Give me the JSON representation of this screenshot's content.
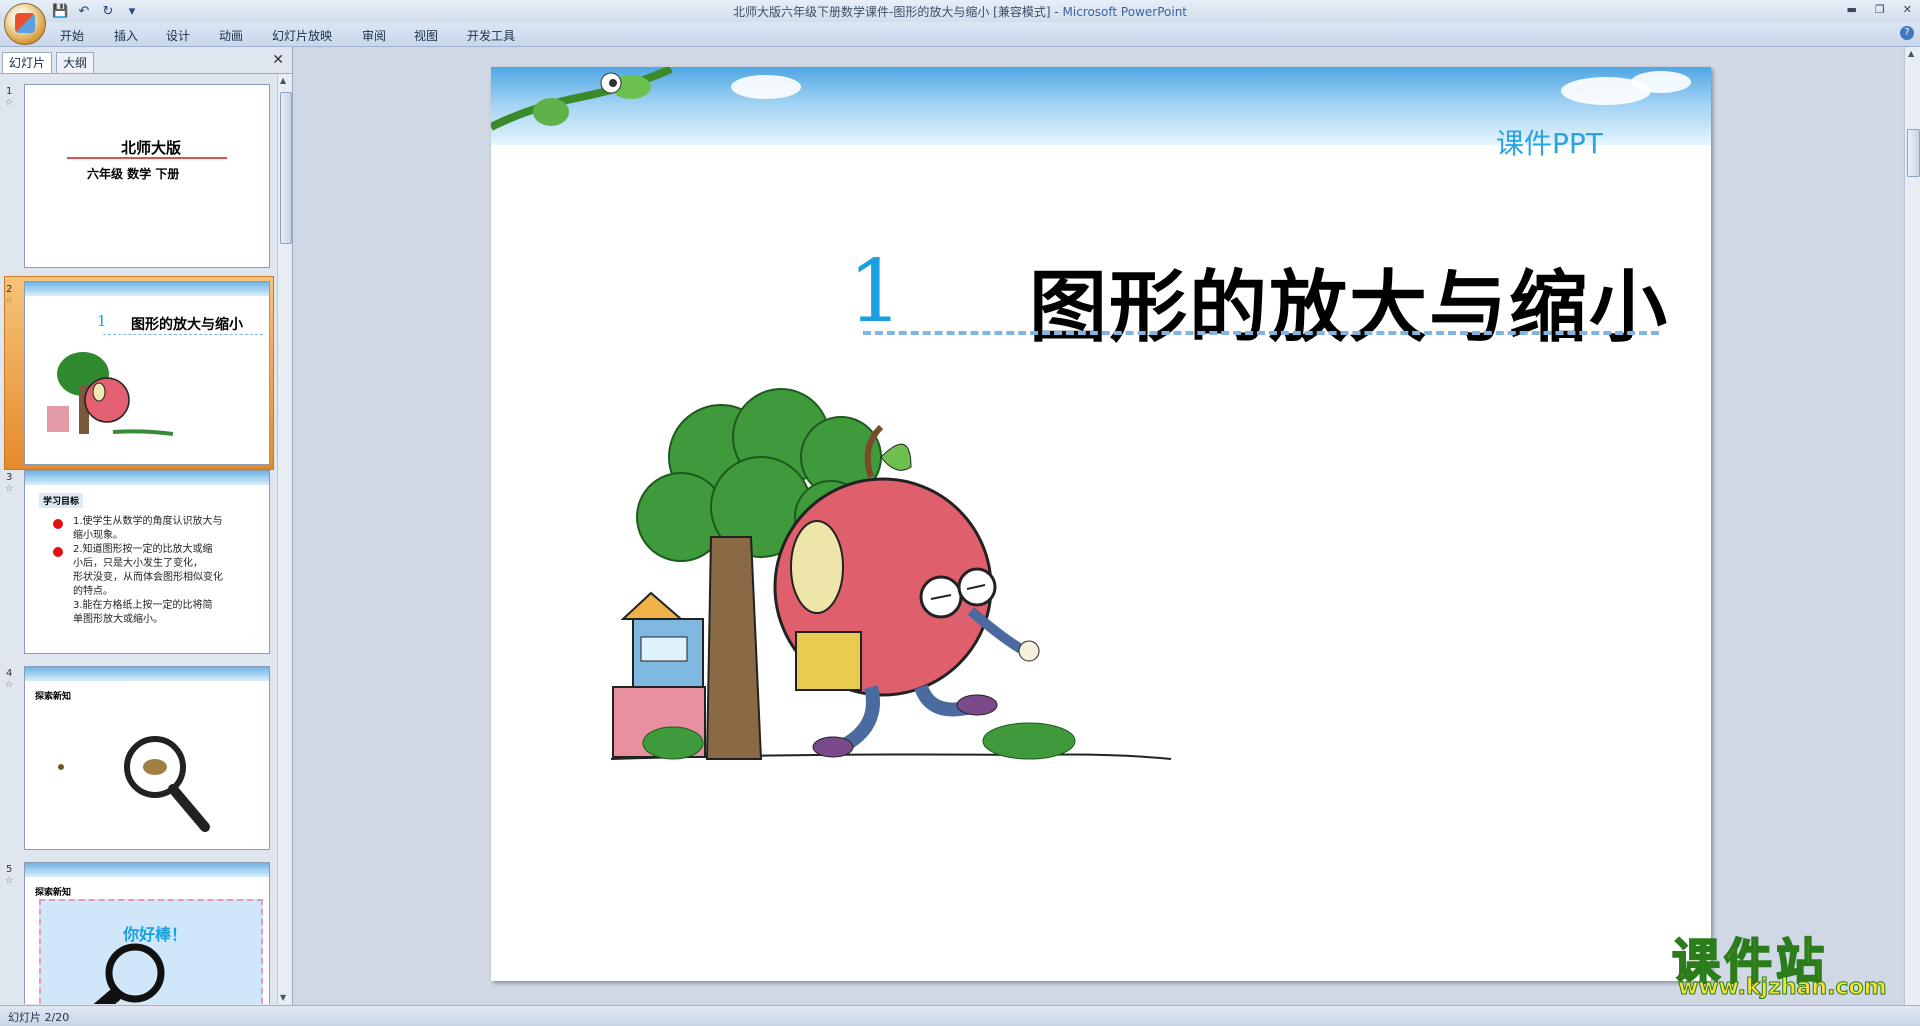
{
  "window": {
    "title": "北师大版六年级下册数学课件-图形的放大与缩小 [兼容模式]",
    "app_name": "Microsoft PowerPoint"
  },
  "qat": {
    "save": "💾",
    "undo": "↶",
    "redo": "↻",
    "more": "▾"
  },
  "ribbon": {
    "tabs": [
      "开始",
      "插入",
      "设计",
      "动画",
      "幻灯片放映",
      "审阅",
      "视图",
      "开发工具"
    ]
  },
  "left_pane": {
    "tabs": [
      "幻灯片",
      "大纲"
    ],
    "close": "✕",
    "slides": [
      {
        "num": "1",
        "title": "北师大版",
        "subtitle": "六年级  数学 下册"
      },
      {
        "num": "2",
        "mini_num": "1",
        "title": "图形的放大与缩小"
      },
      {
        "num": "3",
        "header": "学习目标",
        "lines": [
          "1.使学生从数学的角度认识放大与",
          "缩小现象。",
          "2.知道图形按一定的比放大或缩",
          "小后，只是大小发生了变化，",
          "形状没变，从而体会图形相似变化",
          "的特点。",
          "3.能在方格纸上按一定的比将简",
          "单图形放大或缩小。"
        ]
      },
      {
        "num": "4",
        "header": "探索新知"
      },
      {
        "num": "5",
        "header": "探索新知",
        "banner": "你好棒！"
      }
    ]
  },
  "slide": {
    "corner_label": "课件PPT",
    "number": "1",
    "title": "图形的放大与缩小"
  },
  "status": {
    "slide_info": "幻灯片 2/20"
  },
  "watermark": {
    "brand": "课件站",
    "url": "www.kjzhan.com"
  },
  "colors": {
    "accent": "#1aa0e0",
    "selection": "#e48a2c",
    "ribbon": "#d3deec"
  }
}
